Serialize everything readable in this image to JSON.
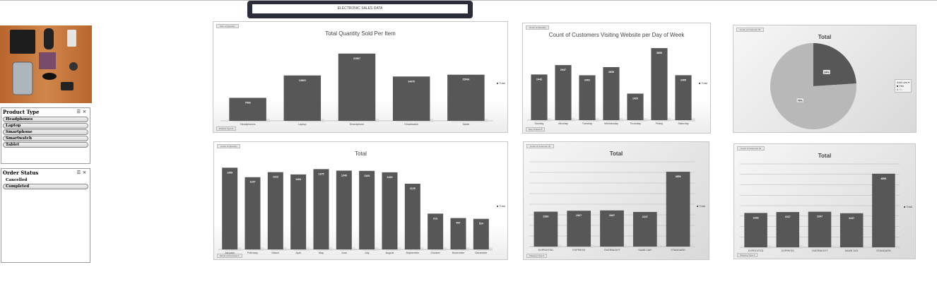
{
  "dashboard": {
    "title": "ELECTRONIC SALES DATA"
  },
  "photo": {
    "description_icon": "product-photo"
  },
  "slicers": [
    {
      "title": "Product Type",
      "items": [
        "Headphones",
        "Laptop",
        "Smartphone",
        "Smartwatch",
        "Tablet"
      ]
    },
    {
      "title": "Order Status",
      "items": [
        "Cancelled",
        "Completed"
      ]
    }
  ],
  "chart_data": [
    {
      "type": "bar",
      "title": "Total Quantity Sold Per Item",
      "field_tag": "Sum of Quantity",
      "filter_tag": "Product Type",
      "legend": "Total",
      "categories": [
        "Headphones",
        "Laptop",
        "Smartphone",
        "Smartwatch",
        "Tablet"
      ],
      "values": [
        7503,
        14823,
        21967,
        14470,
        15066
      ],
      "ylim": [
        0,
        24000
      ]
    },
    {
      "type": "bar",
      "title": "Count of Customers Visiting Website per Day of Week",
      "field_tag": "Count of Quantity",
      "filter_tag": "Day of Week",
      "legend": "Total",
      "categories": [
        "Sunday",
        "Monday",
        "Tuesday",
        "Wednesday",
        "Thursday",
        "Friday",
        "Saturday"
      ],
      "values": [
        2443,
        2947,
        2402,
        2839,
        1420,
        3856,
        2405
      ],
      "ylim": [
        0,
        4200
      ]
    },
    {
      "type": "pie",
      "title": "Total",
      "field_tag": "Count of Customer ID",
      "legend_title": "Add-ons",
      "legend": [
        "Yes",
        "No"
      ],
      "categories": [
        "Yes",
        "No"
      ],
      "values": [
        24,
        76
      ]
    },
    {
      "type": "bar",
      "title": "Total",
      "field_tag": "Count of Quantity",
      "filter_tag": "Month of Purchase",
      "legend": "Total",
      "categories": [
        "January",
        "February",
        "March",
        "April",
        "May",
        "June",
        "July",
        "August",
        "September",
        "October",
        "November",
        "December"
      ],
      "values": [
        1399,
        1237,
        1323,
        1284,
        1375,
        1349,
        1345,
        1320,
        1125,
        613,
        537,
        524
      ],
      "ylim": [
        0,
        1500
      ]
    },
    {
      "type": "bar",
      "title": "Total",
      "field_tag": "Count of Customer ID",
      "filter_tag": "Shipping Type",
      "legend": "Total",
      "categories": [
        "EXPEDITED",
        "EXPRESS",
        "OVERNIGHT",
        "SAME DAY",
        "STANDARD"
      ],
      "values": [
        2266,
        2327,
        2347,
        2247,
        4856
      ],
      "ylim": [
        0,
        5500
      ]
    },
    {
      "type": "bar",
      "title": "Total",
      "field_tag": "Count of Customer ID",
      "filter_tag": "Shipping Type",
      "legend": "Total",
      "categories": [
        "EXPEDITED",
        "EXPRESS",
        "OVERNIGHT",
        "SAME DAY",
        "STANDARD"
      ],
      "values": [
        2266,
        2327,
        2347,
        2247,
        4856
      ],
      "ylim": [
        0,
        5500
      ]
    }
  ]
}
